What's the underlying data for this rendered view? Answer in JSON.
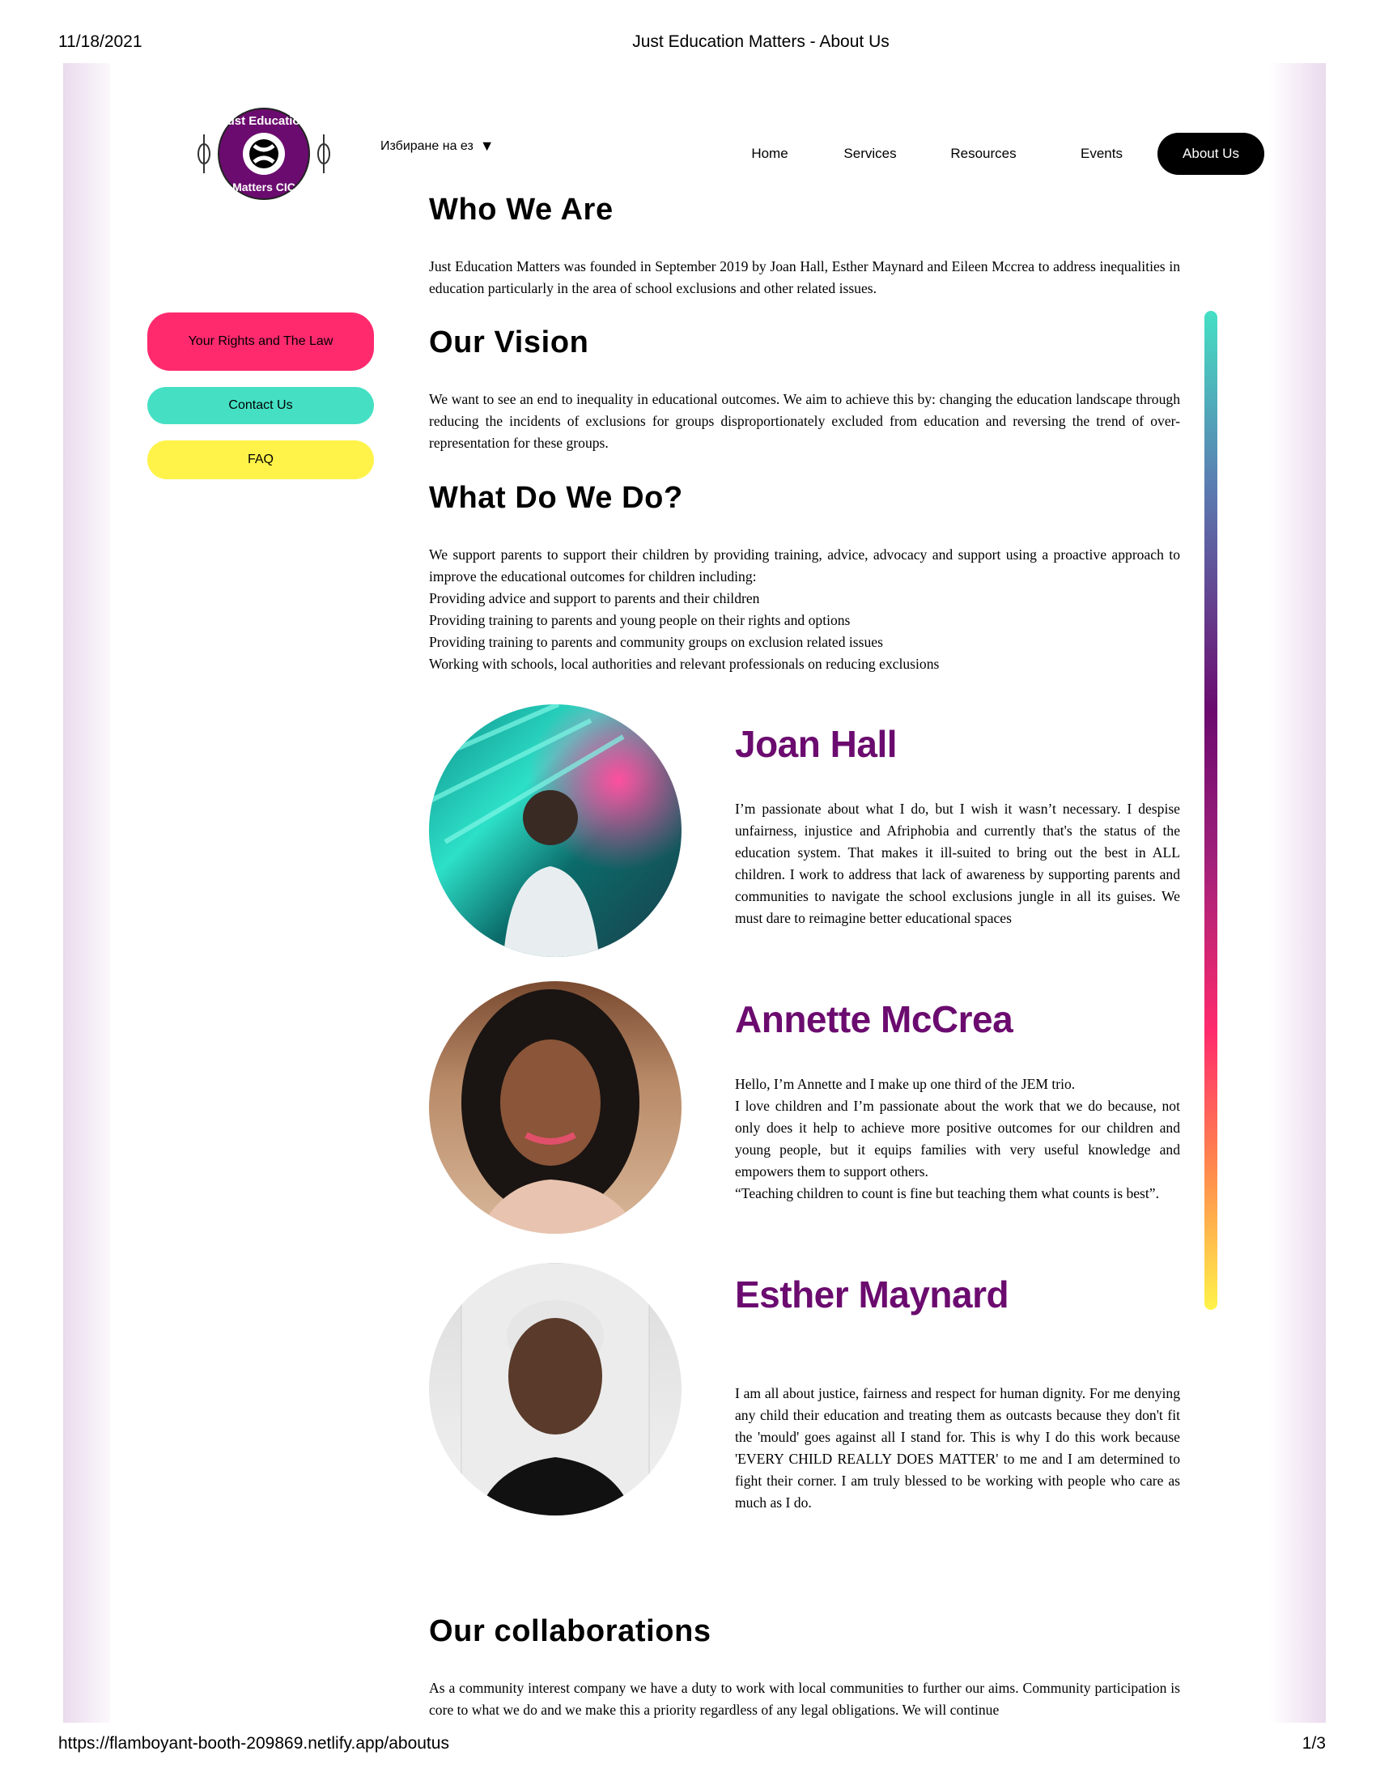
{
  "print_header": {
    "date": "11/18/2021",
    "title": "Just Education Matters - About Us"
  },
  "print_footer": {
    "url": "https://flamboyant-booth-209869.netlify.app/aboutus",
    "page": "1/3"
  },
  "logo": {
    "text_top": "Just Education",
    "text_bottom": "Matters CIC"
  },
  "language_selector": {
    "label": "Избиране на ез",
    "arrow": "▼"
  },
  "nav": {
    "home": "Home",
    "services": "Services",
    "resources": "Resources",
    "events": "Events",
    "about": "About Us"
  },
  "sidebar": {
    "rights": "Your Rights and The Law",
    "contact": "Contact Us",
    "faq": "FAQ"
  },
  "sections": {
    "who_title": "Who We Are",
    "who_text": "Just Education Matters was founded in September 2019 by Joan Hall, Esther Maynard and Eileen Mccrea to address inequalities in education particularly in the area of school exclusions and other related issues.",
    "vision_title": "Our Vision",
    "vision_text": "We want to see an end to inequality in educational outcomes. We aim to achieve this by: changing the education landscape through reducing the incidents of exclusions for groups disproportionately excluded from education and reversing the trend of over-representation for these groups.",
    "do_title": "What Do We Do?",
    "do_intro": "We support parents to support their children by providing training, advice, advocacy and support using a proactive approach to improve the educational outcomes for children including:",
    "do_items": [
      "Providing advice and support to parents and their children",
      "Providing training to parents and young people on their rights and options",
      "Providing training to parents and community groups on exclusion related issues",
      "Working with schools, local authorities and relevant professionals on reducing exclusions"
    ],
    "collab_title": "Our collaborations",
    "collab_text": "As a community interest company we have a duty to work with local communities to further our aims. Community participation is core to what we do and we make this a priority regardless of any legal obligations. We will continue"
  },
  "team": [
    {
      "name": "Joan Hall",
      "bio": [
        "I’m passionate about what I do, but I wish it wasn’t necessary. I despise unfairness, injustice and Afriphobia and currently that's the status of the education system. That makes it ill-suited to bring out the best in ALL children. I work to address that lack of awareness by supporting parents and communities to navigate the school exclusions jungle in all its guises. We must dare to reimagine better educational spaces"
      ]
    },
    {
      "name": "Annette McCrea",
      "bio": [
        "Hello, I’m Annette and I make up one third of the JEM trio.",
        "I love children and I’m passionate about the work that we do because, not only does it help to achieve more positive outcomes for our children and young people, but it equips families with very useful knowledge and empowers them to support others.",
        "“Teaching children to count is fine but teaching them what counts is best”."
      ]
    },
    {
      "name": "Esther Maynard",
      "bio": [
        "I am all about justice, fairness and respect for human dignity. For me denying any child their education and treating them as outcasts because they don't fit the 'mould' goes against all I stand for. This is why I do this work because 'EVERY CHILD REALLY DOES MATTER' to me and I am determined to fight their corner. I am truly blessed to be working with people who care as much as I do."
      ]
    }
  ],
  "colors": {
    "accent_purple": "#6b0b6f",
    "pink": "#ff2a6d",
    "teal": "#45e0c4",
    "yellow": "#fff34a"
  }
}
